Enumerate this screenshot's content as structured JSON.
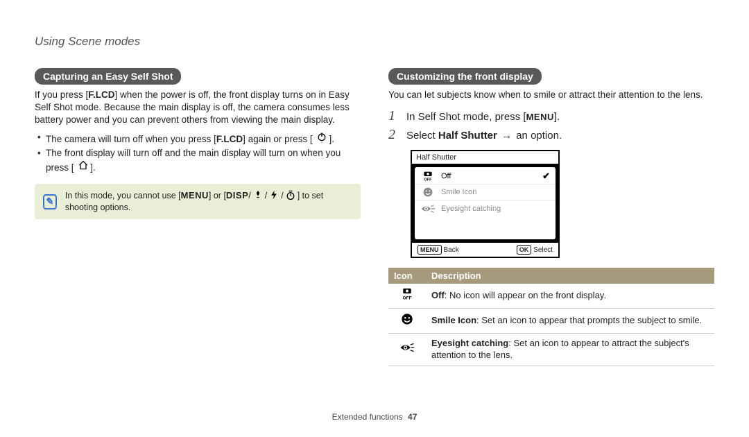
{
  "page_section": "Using Scene modes",
  "footer": {
    "label": "Extended functions",
    "page": "47"
  },
  "left": {
    "heading": "Capturing an Easy Self Shot",
    "intro_a": "If you press [",
    "intro_flcd": "F.LCD",
    "intro_b": "] when the power is off, the front display turns on in Easy Self Shot mode. Because the main display is off, the camera consumes less battery power and you can prevent others from viewing the main display.",
    "bullet1_a": "The camera will turn off when you press [",
    "bullet1_flcd": "F.LCD",
    "bullet1_b": "] again or press [",
    "bullet1_c": "].",
    "bullet2_a": "The front display will turn off and the main display will turn on when you press [",
    "bullet2_b": "].",
    "note_a": "In this mode, you cannot use [",
    "note_menu": "MENU",
    "note_b": "] or [",
    "note_disp": "DISP",
    "note_c": "] to set shooting options."
  },
  "right": {
    "heading": "Customizing the front display",
    "intro": "You can let subjects know when to smile or attract their attention to the lens.",
    "step1_a": "In Self Shot mode, press [",
    "step1_menu": "MENU",
    "step1_b": "].",
    "step2_a": "Select ",
    "step2_bold": "Half Shutter",
    "step2_b": " an option.",
    "ui": {
      "title": "Half Shutter",
      "row1": "Off",
      "row2": "Smile Icon",
      "row3": "Eyesight catching",
      "back_label": "Back",
      "back_chip": "MENU",
      "select_label": "Select",
      "select_chip": "OK"
    },
    "table": {
      "h1": "Icon",
      "h2": "Description",
      "r1_bold": "Off",
      "r1_rest": ": No icon will appear on the front display.",
      "r2_bold": "Smile Icon",
      "r2_rest": ": Set an icon to appear that prompts the subject to smile.",
      "r3_bold": "Eyesight catching",
      "r3_rest": ": Set an icon to appear to attract the subject's attention to the lens."
    }
  }
}
